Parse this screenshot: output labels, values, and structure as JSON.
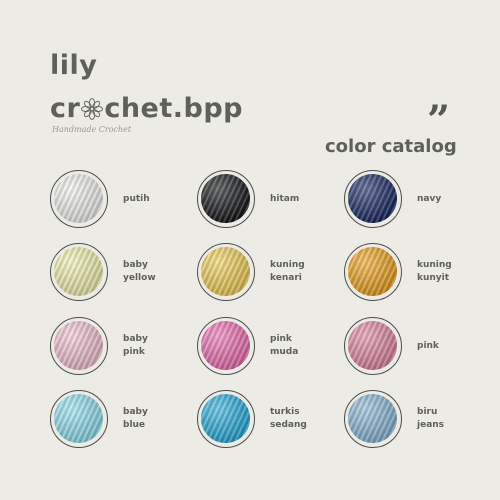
{
  "brand": {
    "top_word": "lily",
    "name_before": "cr",
    "name_after": "chet.bpp",
    "tagline": "Handmade Crochet",
    "quote_mark": "”"
  },
  "catalog_title": "color catalog",
  "colors": [
    {
      "line1": "putih",
      "line2": "",
      "hex": "#f6f6f4"
    },
    {
      "line1": "hitam",
      "line2": "",
      "hex": "#15171a"
    },
    {
      "line1": "navy",
      "line2": "",
      "hex": "#1a2a66"
    },
    {
      "line1": "baby",
      "line2": "yellow",
      "hex": "#f7f6b3"
    },
    {
      "line1": "kuning",
      "line2": "kenari",
      "hex": "#f5d35a"
    },
    {
      "line1": "kuning",
      "line2": "kunyit",
      "hex": "#f0a521"
    },
    {
      "line1": "baby",
      "line2": "pink",
      "hex": "#f6c6d6"
    },
    {
      "line1": "pink",
      "line2": "muda",
      "hex": "#f171b4"
    },
    {
      "line1": "pink",
      "line2": "",
      "hex": "#e28aa5"
    },
    {
      "line1": "baby",
      "line2": "blue",
      "hex": "#93e4f4"
    },
    {
      "line1": "turkis",
      "line2": "sedang",
      "hex": "#2bb0e0"
    },
    {
      "line1": "biru",
      "line2": "jeans",
      "hex": "#8db9d8"
    }
  ]
}
